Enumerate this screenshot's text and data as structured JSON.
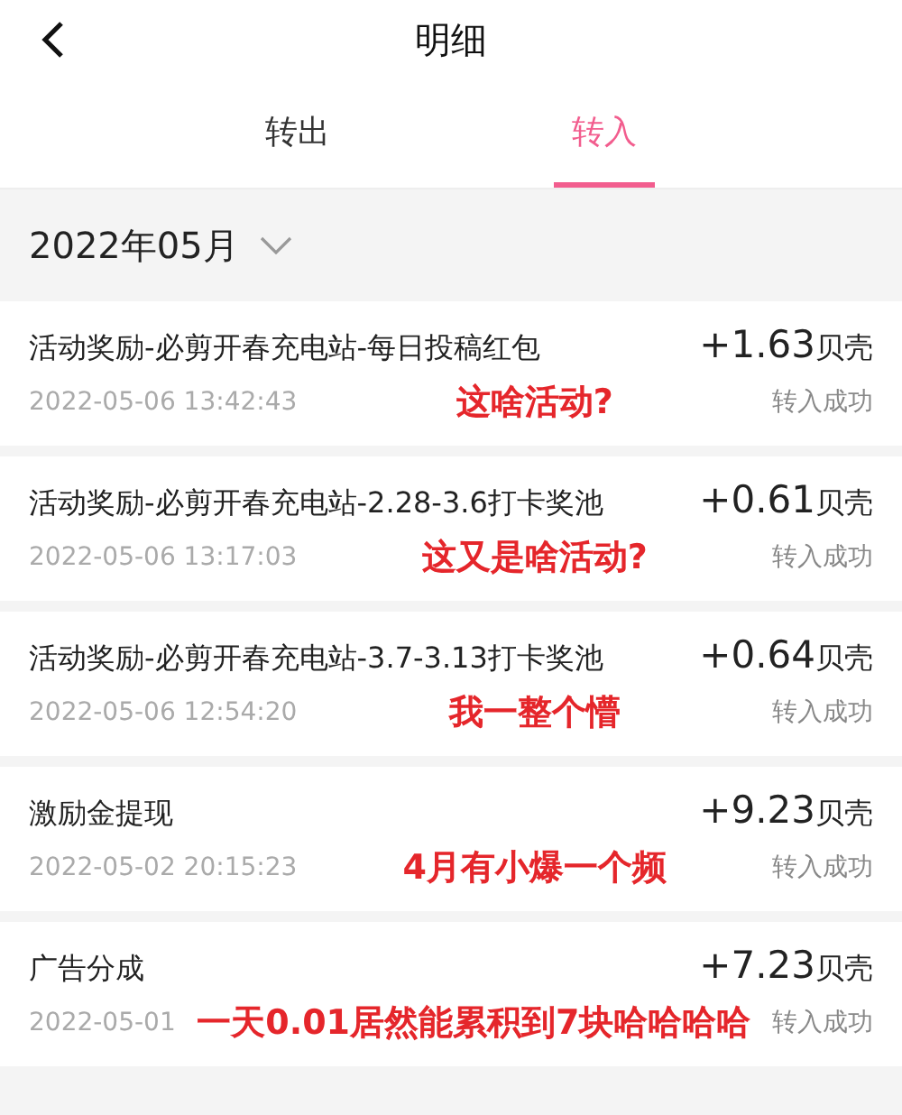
{
  "header": {
    "title": "明细"
  },
  "tabs": [
    {
      "label": "转出",
      "selected": false
    },
    {
      "label": "转入",
      "selected": true
    }
  ],
  "month_filter": {
    "label": "2022年05月"
  },
  "records": [
    {
      "title": "活动奖励-必剪开春充电站-每日投稿红包",
      "amount": "+1.63",
      "unit": "贝壳",
      "time": "2022-05-06 13:42:43",
      "status": "转入成功",
      "note": "这啥活动?"
    },
    {
      "title": "活动奖励-必剪开春充电站-2.28-3.6打卡奖池",
      "amount": "+0.61",
      "unit": "贝壳",
      "time": "2022-05-06 13:17:03",
      "status": "转入成功",
      "note": "这又是啥活动?"
    },
    {
      "title": "活动奖励-必剪开春充电站-3.7-3.13打卡奖池",
      "amount": "+0.64",
      "unit": "贝壳",
      "time": "2022-05-06 12:54:20",
      "status": "转入成功",
      "note": "我一整个懵"
    },
    {
      "title": "激励金提现",
      "amount": "+9.23",
      "unit": "贝壳",
      "time": "2022-05-02 20:15:23",
      "status": "转入成功",
      "note": "4月有小爆一个频"
    },
    {
      "title": "广告分成",
      "amount": "+7.23",
      "unit": "贝壳",
      "time": "2022-05-01",
      "status": "转入成功",
      "note": "一天0.01居然能累积到7块哈哈哈哈"
    }
  ]
}
